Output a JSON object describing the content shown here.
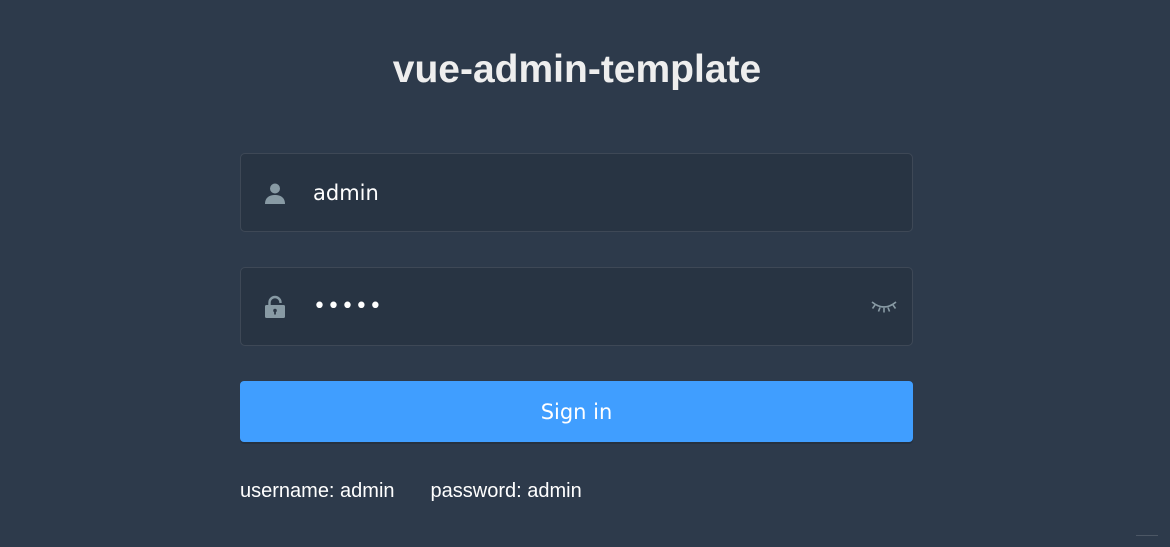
{
  "app": {
    "title": "vue-admin-template"
  },
  "login_form": {
    "username": {
      "value": "admin",
      "icon": "user-icon"
    },
    "password": {
      "value": "admin",
      "icon": "lock-icon",
      "toggle_icon": "eye-closed-icon"
    },
    "submit_label": "Sign in"
  },
  "tips": {
    "username": "username: admin",
    "password": "password: admin"
  },
  "colors": {
    "background": "#2d3a4b",
    "input_bg": "#283443",
    "icon": "#889aa4",
    "primary": "#409eff",
    "title": "#eeeeee"
  }
}
